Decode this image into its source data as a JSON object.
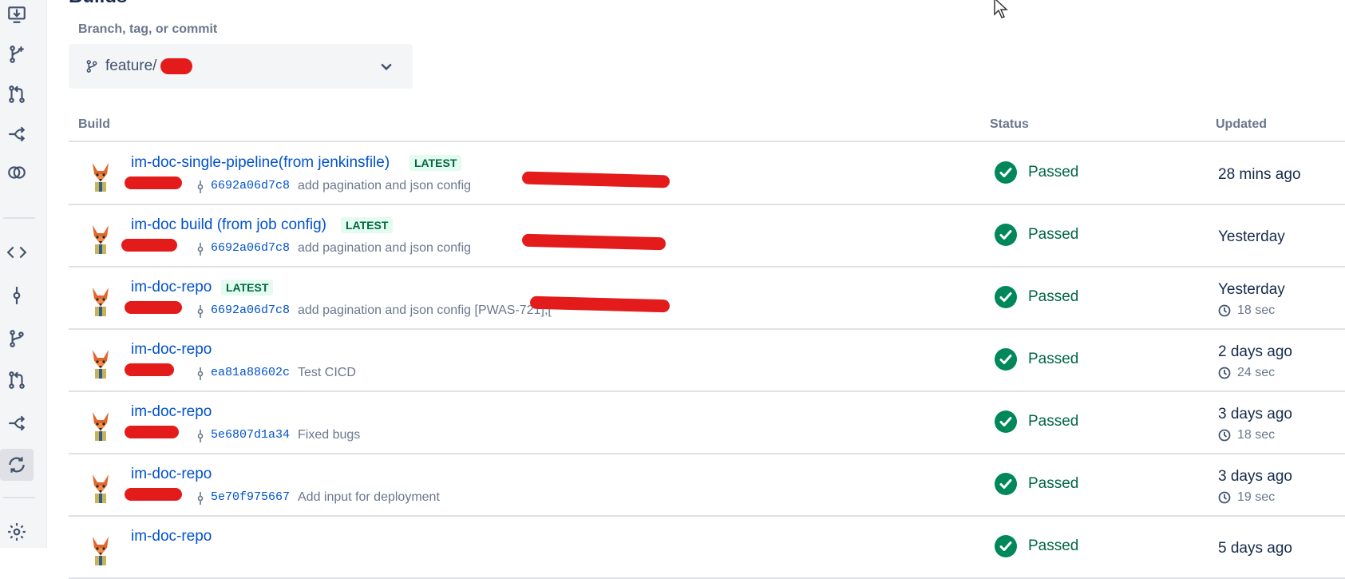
{
  "page": {
    "title": "Builds"
  },
  "branch_filter": {
    "label": "Branch, tag, or commit",
    "value": "feature/"
  },
  "table": {
    "headers": {
      "build": "Build",
      "status": "Status",
      "updated": "Updated"
    },
    "rows": [
      {
        "name": "im-doc-single-pipeline(from jenkinsfile)",
        "latest": "LATEST",
        "hash": "6692a06d7c8",
        "message": "add pagination and json config",
        "status": "Passed",
        "updated": "28 mins ago",
        "duration": ""
      },
      {
        "name": "im-doc build (from job config)",
        "latest": "LATEST",
        "hash": "6692a06d7c8",
        "message": "add pagination and json config",
        "status": "Passed",
        "updated": "Yesterday",
        "duration": ""
      },
      {
        "name": "im-doc-repo",
        "latest": "LATEST",
        "hash": "6692a06d7c8",
        "message": "add pagination and json config [PWAS-721],[",
        "status": "Passed",
        "updated": "Yesterday",
        "duration": "18 sec"
      },
      {
        "name": "im-doc-repo",
        "latest": "",
        "hash": "ea81a88602c",
        "message": "Test CICD",
        "status": "Passed",
        "updated": "2 days ago",
        "duration": "24 sec"
      },
      {
        "name": "im-doc-repo",
        "latest": "",
        "hash": "5e6807d1a34",
        "message": "Fixed bugs",
        "status": "Passed",
        "updated": "3 days ago",
        "duration": "18 sec"
      },
      {
        "name": "im-doc-repo",
        "latest": "",
        "hash": "5e70f975667",
        "message": "Add input for deployment",
        "status": "Passed",
        "updated": "3 days ago",
        "duration": "19 sec"
      },
      {
        "name": "im-doc-repo",
        "latest": "",
        "hash": "",
        "message": "",
        "status": "Passed",
        "updated": "5 days ago",
        "duration": ""
      }
    ]
  },
  "sidebar": {
    "icons": [
      "download-icon",
      "branch-plus-icon",
      "pull-request-icon",
      "pipeline-icon",
      "overlap-icon",
      "code-icon",
      "commit-icon",
      "branches-icon",
      "pull-requests-icon",
      "deployments-icon",
      "builds-icon",
      "settings-icon"
    ]
  },
  "colors": {
    "link": "#0052cc",
    "passed": "#006644",
    "latest_bg": "#e3fcef",
    "redaction": "#e41b1b"
  }
}
